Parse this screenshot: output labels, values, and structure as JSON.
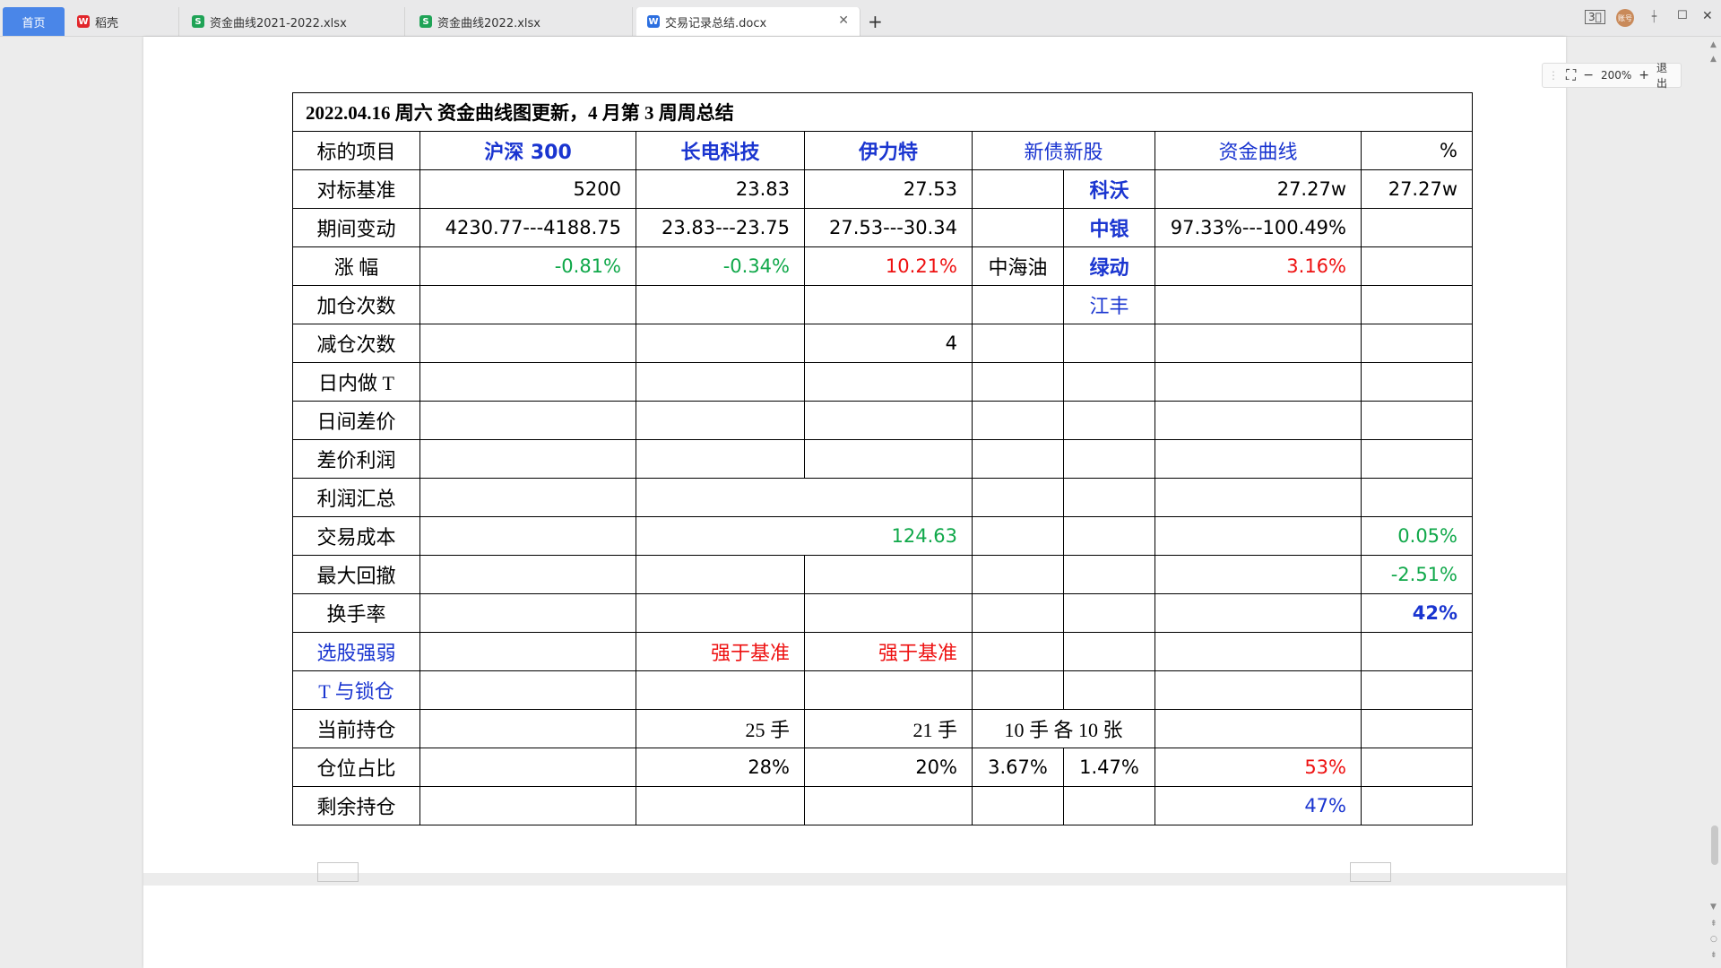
{
  "tabs": [
    {
      "label": "首页"
    },
    {
      "label": "稻壳",
      "icon": "wps-logo-icon",
      "color": "#e2262b"
    },
    {
      "label": "资金曲线2021-2022.xlsx",
      "icon": "spreadsheet-icon",
      "color": "#1fa356"
    },
    {
      "label": "资金曲线2022.xlsx",
      "icon": "spreadsheet-icon",
      "color": "#1fa356"
    },
    {
      "label": "交易记录总结.docx",
      "icon": "document-icon",
      "color": "#2c6fe0"
    }
  ],
  "window": {
    "avatar": "账号"
  },
  "zoom": {
    "level": "200%",
    "exit_label": "退出"
  },
  "table": {
    "title": "2022.04.16  周六  资金曲线图更新，4 月第 3 周周总结",
    "header": [
      "标的项目",
      "沪深 300",
      "长电科技",
      "伊力特",
      "新债新股",
      "资金曲线",
      "%"
    ],
    "rows": {
      "benchmark": {
        "label": "对标基准",
        "hs300": "5200",
        "cd": "23.83",
        "ylt": "27.53",
        "sub": "科沃",
        "curve": "27.27w",
        "pct": "27.27w"
      },
      "change": {
        "label": "期间变动",
        "hs300": "4230.77---4188.75",
        "cd": "23.83---23.75",
        "ylt": "27.53---30.34",
        "sub": "中银",
        "curve": "97.33%---100.49%"
      },
      "rise": {
        "label": "涨  幅",
        "hs300": "-0.81%",
        "cd": "-0.34%",
        "ylt": "10.21%",
        "new": "中海油",
        "sub": "绿动",
        "curve": "3.16%"
      },
      "add": {
        "label": "加仓次数",
        "sub": "江丰"
      },
      "reduce": {
        "label": "减仓次数",
        "ylt": "4"
      },
      "intraday": {
        "label": "日内做 T"
      },
      "interday": {
        "label": "日间差价"
      },
      "spread_profit": {
        "label": "差价利润"
      },
      "profit_total": {
        "label": "利润汇总"
      },
      "cost": {
        "label": "交易成本",
        "value": "124.63",
        "pct": "0.05%"
      },
      "drawdown": {
        "label": "最大回撤",
        "pct": "-2.51%"
      },
      "turnover": {
        "label": "换手率",
        "pct": "42%"
      },
      "pick": {
        "label": "选股强弱",
        "cd": "强于基准",
        "ylt": "强于基准"
      },
      "tlock": {
        "label": "T 与锁仓"
      },
      "holding": {
        "label": "当前持仓",
        "cd": "25 手",
        "ylt": "21 手",
        "new": "10 手  各 10 张"
      },
      "ratio": {
        "label": "仓位占比",
        "cd": "28%",
        "ylt": "20%",
        "new": "3.67%",
        "sub": "1.47%",
        "curve": "53%"
      },
      "remain": {
        "label": "剩余持仓",
        "curve": "47%"
      }
    }
  }
}
